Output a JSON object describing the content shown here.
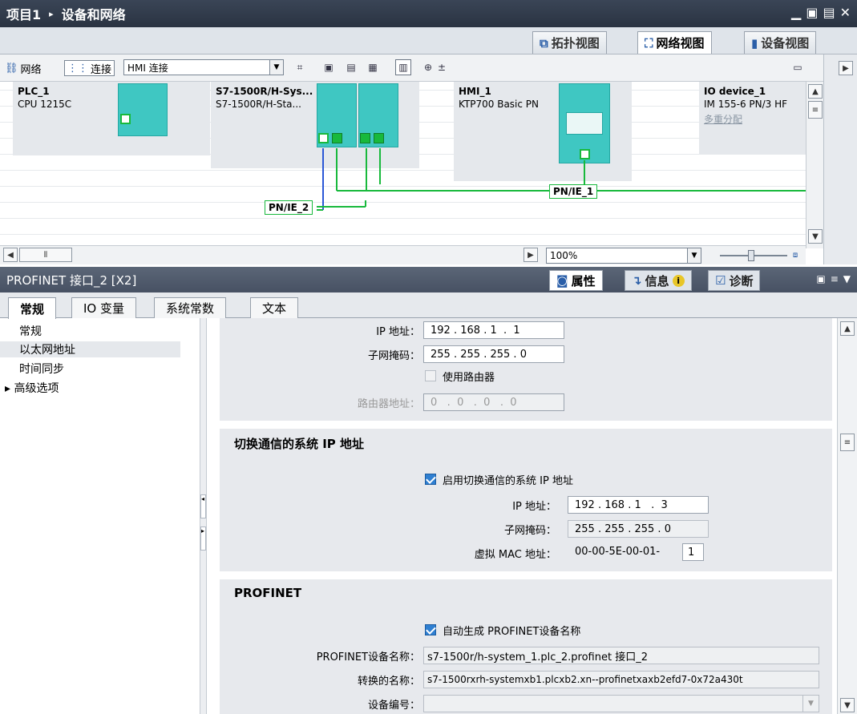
{
  "title": {
    "project": "项目1",
    "separator": "▸",
    "page": "设备和网络"
  },
  "window_controls": [
    "▁",
    "▣",
    "▤",
    "✕"
  ],
  "view_tabs": [
    {
      "label": "拓扑视图",
      "active": false
    },
    {
      "label": "网络视图",
      "active": true
    },
    {
      "label": "设备视图",
      "active": false
    }
  ],
  "toolbar": {
    "network": "网络",
    "connect": "连接",
    "connection_type": "HMI 连接"
  },
  "devices": [
    {
      "name": "PLC_1",
      "type": "CPU 1215C"
    },
    {
      "name": "S7-1500R/H-Sys...",
      "type": "S7-1500R/H-Sta..."
    },
    {
      "name": "HMI_1",
      "type": "KTP700 Basic PN"
    },
    {
      "name": "IO device_1",
      "type": "IM 155-6 PN/3 HF",
      "link": "多重分配"
    }
  ],
  "networks": [
    "PN/IE_1",
    "PN/IE_2"
  ],
  "zoom": "100%",
  "inspector": {
    "title": "PROFINET 接口_2 [X2]",
    "tabs": [
      {
        "label": "属性",
        "active": true
      },
      {
        "label": "信息",
        "active": false
      },
      {
        "label": "诊断",
        "active": false
      }
    ]
  },
  "prop_tabs": [
    {
      "label": "常规",
      "active": true
    },
    {
      "label": "IO 变量",
      "active": false
    },
    {
      "label": "系统常数",
      "active": false
    },
    {
      "label": "文本",
      "active": false
    }
  ],
  "nav": [
    {
      "label": "常规",
      "selected": false
    },
    {
      "label": "以太网地址",
      "selected": true
    },
    {
      "label": "时间同步",
      "selected": false
    },
    {
      "label": "▸ 高级选项",
      "selected": false
    }
  ],
  "ip": {
    "ip_label": "IP 地址：",
    "ip": [
      "192",
      "168",
      "1",
      "1"
    ],
    "mask_label": "子网掩码：",
    "mask": [
      "255",
      "255",
      "255",
      "0"
    ],
    "use_router": "使用路由器",
    "router_label": "路由器地址：",
    "router": [
      "0",
      "0",
      "0",
      "0"
    ]
  },
  "switch_ip": {
    "title": "切换通信的系统 IP 地址",
    "enable": "启用切换通信的系统 IP 地址",
    "ip_label": "IP 地址：",
    "ip": [
      "192",
      "168",
      "1",
      "3"
    ],
    "mask_label": "子网掩码：",
    "mask": [
      "255",
      "255",
      "255",
      "0"
    ],
    "mac_label": "虚拟 MAC 地址：",
    "mac_prefix": "00-00-5E-00-01-",
    "mac_suffix": "1"
  },
  "profinet": {
    "title": "PROFINET",
    "auto": "自动生成 PROFINET设备名称",
    "name_label": "PROFINET设备名称：",
    "name": "s7-1500r/h-system_1.plc_2.profinet 接口_2",
    "conv_label": "转换的名称：",
    "conv": "s7-1500rxrh-systemxb1.plcxb2.xn--profinetxaxb2efd7-0x72a430t",
    "num_label": "设备编号："
  }
}
